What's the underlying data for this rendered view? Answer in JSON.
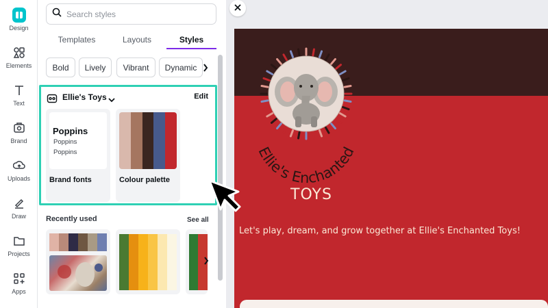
{
  "rail": {
    "items": [
      {
        "label": "Design",
        "icon": "design-icon"
      },
      {
        "label": "Elements",
        "icon": "elements-icon"
      },
      {
        "label": "Text",
        "icon": "text-icon"
      },
      {
        "label": "Brand",
        "icon": "brand-icon"
      },
      {
        "label": "Uploads",
        "icon": "uploads-icon"
      },
      {
        "label": "Draw",
        "icon": "draw-icon"
      },
      {
        "label": "Projects",
        "icon": "projects-icon"
      },
      {
        "label": "Apps",
        "icon": "apps-icon"
      }
    ]
  },
  "search": {
    "placeholder": "Search styles",
    "value": ""
  },
  "tabs": [
    {
      "label": "Templates"
    },
    {
      "label": "Layouts"
    },
    {
      "label": "Styles",
      "active": true
    }
  ],
  "chips": [
    "Bold",
    "Lively",
    "Vibrant",
    "Dynamic"
  ],
  "brand_kit": {
    "title": "Ellie's Toys",
    "edit_label": "Edit",
    "fonts_card": {
      "label": "Brand fonts",
      "lines": [
        "Poppins",
        "Poppins",
        "Poppins"
      ]
    },
    "palette_card": {
      "label": "Colour palette",
      "colors": [
        "#d9b8ac",
        "#a57660",
        "#3a2620",
        "#475a8c",
        "#c1272d"
      ]
    }
  },
  "recent": {
    "title": "Recently used",
    "see_all_label": "See all",
    "palette1": [
      "#e0b3a6",
      "#b98a7a",
      "#2f2b46",
      "#6e5742",
      "#a89a85",
      "#6f7fb0"
    ],
    "palette2": [
      "#4a7a32",
      "#e58f0f",
      "#f7b21a",
      "#f9c545",
      "#fce8b0",
      "#fbf6e3"
    ],
    "palette3": [
      "#2e7a33",
      "#c7392f",
      "#f4f4f4"
    ]
  },
  "canvas": {
    "brand_name": "Ellie's Enchanted",
    "subtitle": "TOYS",
    "tagline": "Let's play, dream, and grow together at Ellie's Enchanted Toys!",
    "colors": {
      "top": "#3a1d1c",
      "main": "#c1272d",
      "text": "#fbe9d7"
    }
  },
  "accent": "#7d2ae8",
  "highlight": "#2ed0b4"
}
